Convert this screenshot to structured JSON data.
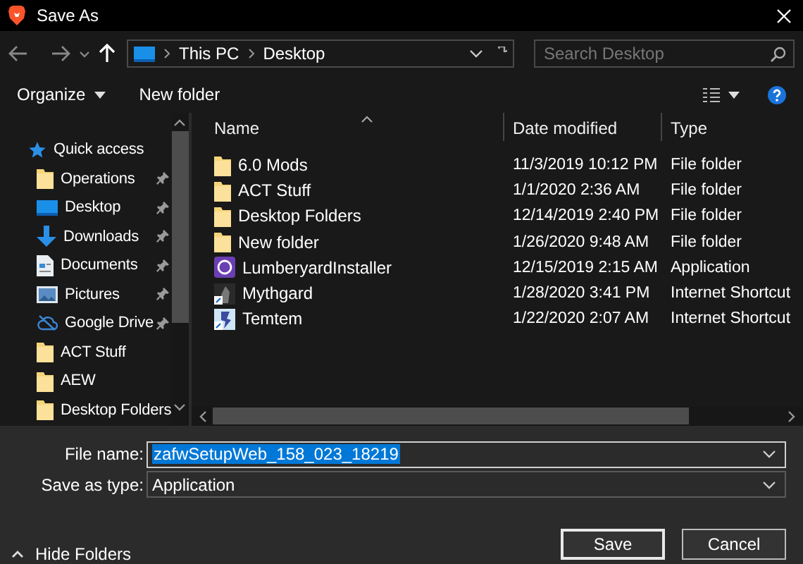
{
  "window": {
    "title": "Save As"
  },
  "address": {
    "path": [
      "This PC",
      "Desktop"
    ]
  },
  "search": {
    "placeholder": "Search Desktop"
  },
  "toolbar": {
    "organize": "Organize",
    "new_folder": "New folder"
  },
  "sidebar": {
    "items": [
      {
        "label": "Quick access",
        "kind": "star",
        "pinned": false,
        "top": true
      },
      {
        "label": "Operations",
        "kind": "folder",
        "pinned": true,
        "top": false
      },
      {
        "label": "Desktop",
        "kind": "desktop",
        "pinned": true,
        "top": false
      },
      {
        "label": "Downloads",
        "kind": "download",
        "pinned": true,
        "top": false
      },
      {
        "label": "Documents",
        "kind": "document",
        "pinned": true,
        "top": false
      },
      {
        "label": "Pictures",
        "kind": "pictures",
        "pinned": true,
        "top": false
      },
      {
        "label": "Google Drive",
        "kind": "cloud",
        "pinned": true,
        "top": false
      },
      {
        "label": "ACT Stuff",
        "kind": "folder",
        "pinned": false,
        "top": false
      },
      {
        "label": "AEW",
        "kind": "folder",
        "pinned": false,
        "top": false
      },
      {
        "label": "Desktop Folders",
        "kind": "folder",
        "pinned": false,
        "top": false
      }
    ]
  },
  "table": {
    "columns": [
      "Name",
      "Date modified",
      "Type"
    ],
    "rows": [
      {
        "name": "6.0 Mods",
        "date": "11/3/2019 10:12 PM",
        "type": "File folder",
        "kind": "folder"
      },
      {
        "name": "ACT Stuff",
        "date": "1/1/2020 2:36 AM",
        "type": "File folder",
        "kind": "folder"
      },
      {
        "name": "Desktop Folders",
        "date": "12/14/2019 2:40 PM",
        "type": "File folder",
        "kind": "folder"
      },
      {
        "name": "New folder",
        "date": "1/26/2020 9:48 AM",
        "type": "File folder",
        "kind": "folder"
      },
      {
        "name": "LumberyardInstaller",
        "date": "12/15/2019 2:15 AM",
        "type": "Application",
        "kind": "app"
      },
      {
        "name": "Mythgard",
        "date": "1/28/2020 3:41 PM",
        "type": "Internet Shortcut",
        "kind": "shortcut_dark"
      },
      {
        "name": "Temtem",
        "date": "1/22/2020 2:07 AM",
        "type": "Internet Shortcut",
        "kind": "shortcut_light"
      }
    ]
  },
  "form": {
    "file_name_label": "File name:",
    "file_name": "zafwSetupWeb_158_023_18219",
    "type_label": "Save as type:",
    "type": "Application"
  },
  "footer": {
    "hide_folders": "Hide Folders",
    "save": "Save",
    "cancel": "Cancel"
  }
}
